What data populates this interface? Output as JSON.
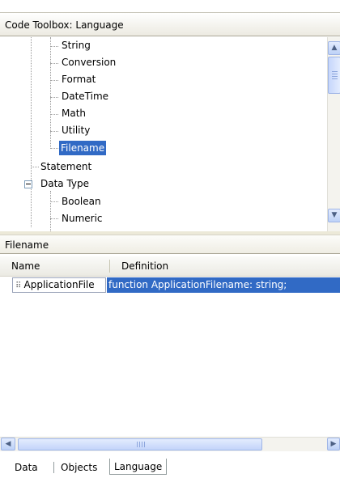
{
  "panel": {
    "title": "Code Toolbox: Language"
  },
  "tree": {
    "items": [
      {
        "label": "String"
      },
      {
        "label": "Conversion"
      },
      {
        "label": "Format"
      },
      {
        "label": "DateTime"
      },
      {
        "label": "Math"
      },
      {
        "label": "Utility"
      },
      {
        "label": "Filename",
        "selected": true
      },
      {
        "label": "Statement"
      },
      {
        "label": "Data Type",
        "expanded": true
      },
      {
        "label": "Boolean"
      },
      {
        "label": "Numeric"
      }
    ]
  },
  "section": {
    "title": "Filename"
  },
  "list": {
    "columns": [
      "Name",
      "Definition"
    ],
    "rows": [
      {
        "name": "ApplicationFile",
        "definition": "function ApplicationFilename: string;"
      }
    ]
  },
  "scrollbar_glyphs": {
    "up": "▲",
    "down": "▼",
    "left": "◀",
    "right": "▶"
  },
  "tabs": [
    {
      "label": "Data"
    },
    {
      "label": "Objects"
    },
    {
      "label": "Language",
      "active": true
    }
  ],
  "colors": {
    "selection": "#316ac5",
    "scroll_accent": "#bdd1f7"
  }
}
